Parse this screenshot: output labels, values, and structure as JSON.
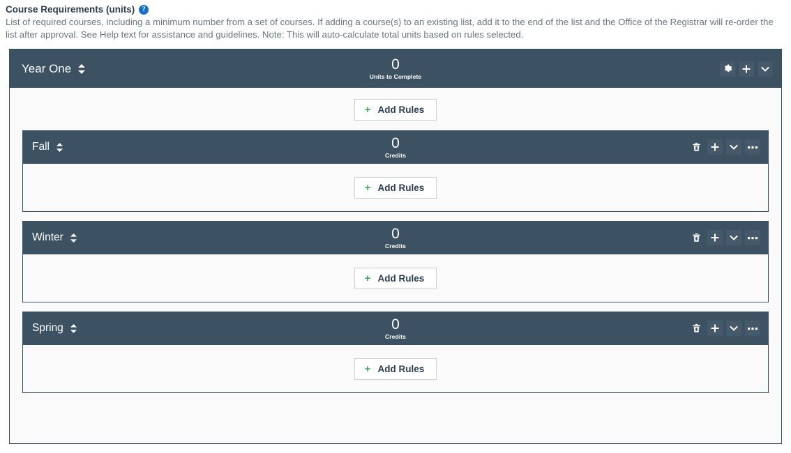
{
  "section": {
    "title": "Course Requirements (units)",
    "help_icon": "help-circle-icon",
    "help_label": "?",
    "description": "List of required courses, including a minimum number from a set of courses. If adding a course(s) to an existing list, add it to the end of the list and the Office of the Registrar will re-order the list after approval. See Help text for assistance and guidelines. Note: This will auto-calculate total units based on rules selected."
  },
  "colors": {
    "header_bar": "#3c5263",
    "icon_button": "#46596a",
    "panel_background": "#fafafa",
    "panel_border": "#37505f",
    "accent_green": "#3aa757",
    "help_blue": "#1a6fc4",
    "title_text": "#2c3e50",
    "description_text": "#6b7780"
  },
  "year": {
    "title": "Year One",
    "sort_icon": "sort-updown-icon",
    "stat_value": "0",
    "stat_label": "Units to Complete",
    "actions": [
      {
        "name": "gear-icon",
        "label": "Settings"
      },
      {
        "name": "plus-icon",
        "label": "Add"
      },
      {
        "name": "chevron-down-icon",
        "label": "Collapse"
      }
    ],
    "add_rules": {
      "plus": "+",
      "label": "Add Rules"
    }
  },
  "terms": [
    {
      "title": "Fall",
      "sort_icon": "sort-updown-icon",
      "stat_value": "0",
      "stat_label": "Credits",
      "actions": [
        {
          "name": "trash-icon",
          "label": "Delete"
        },
        {
          "name": "plus-icon",
          "label": "Add"
        },
        {
          "name": "chevron-down-icon",
          "label": "Collapse"
        },
        {
          "name": "ellipsis-icon",
          "label": "More options"
        }
      ],
      "add_rules": {
        "plus": "+",
        "label": "Add Rules"
      }
    },
    {
      "title": "Winter",
      "sort_icon": "sort-updown-icon",
      "stat_value": "0",
      "stat_label": "Credits",
      "actions": [
        {
          "name": "trash-icon",
          "label": "Delete"
        },
        {
          "name": "plus-icon",
          "label": "Add"
        },
        {
          "name": "chevron-down-icon",
          "label": "Collapse"
        },
        {
          "name": "ellipsis-icon",
          "label": "More options"
        }
      ],
      "add_rules": {
        "plus": "+",
        "label": "Add Rules"
      }
    },
    {
      "title": "Spring",
      "sort_icon": "sort-updown-icon",
      "stat_value": "0",
      "stat_label": "Credits",
      "actions": [
        {
          "name": "trash-icon",
          "label": "Delete"
        },
        {
          "name": "plus-icon",
          "label": "Add"
        },
        {
          "name": "chevron-down-icon",
          "label": "Collapse"
        },
        {
          "name": "ellipsis-icon",
          "label": "More options"
        }
      ],
      "add_rules": {
        "plus": "+",
        "label": "Add Rules"
      }
    }
  ]
}
